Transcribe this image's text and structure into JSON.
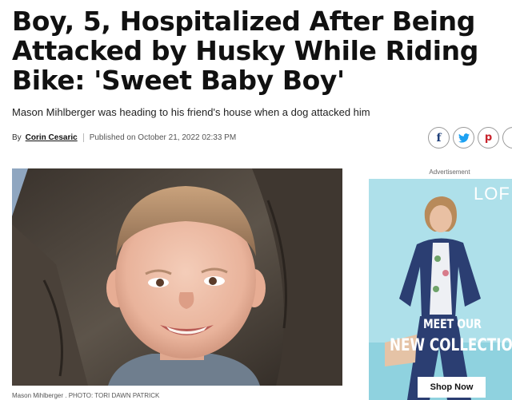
{
  "article": {
    "headline": "Boy, 5, Hospitalized After Being Attacked by Husky While Riding Bike: 'Sweet Baby Boy'",
    "dek": "Mason Mihlberger was heading to his friend's house when a dog attacked him",
    "byline": {
      "by_label": "By",
      "author": "Corin Cesaric",
      "published": "Published on October 21, 2022 02:33 PM"
    },
    "image_caption": "Mason Mihlberger . PHOTO: TORI DAWN PATRICK"
  },
  "social": {
    "facebook": "f",
    "twitter": "🐦",
    "pinterest": "p",
    "icons": [
      "facebook-icon",
      "twitter-icon",
      "pinterest-icon"
    ]
  },
  "ad": {
    "label": "Advertisement",
    "brand": "LOF",
    "line1": "MEET OUR",
    "line2": "NEW COLLECTION",
    "button": "Shop Now",
    "bg_color": "#aee0ea"
  },
  "colors": {
    "text": "#111111",
    "facebook": "#1f3f7a",
    "twitter": "#1da1f2",
    "pinterest": "#c8232c"
  }
}
